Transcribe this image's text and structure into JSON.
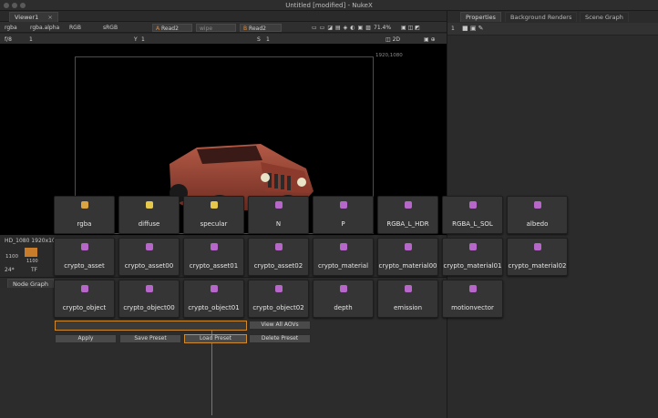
{
  "window": {
    "title": "Untitled [modified] - NukeX"
  },
  "viewer": {
    "tab_label": "Viewer1",
    "channels": "rgba",
    "alpha": "rgba.alpha",
    "colorspace_mode": "RGB",
    "lut": "sRGB",
    "input_a": "Read2",
    "wipe": "wipe",
    "input_b": "Read2",
    "zoom": "71.4%",
    "view_mode": "2D",
    "frame_field": "f/8",
    "frame_value": "1",
    "y_label": "Y",
    "y_value": "1",
    "s_label": "S",
    "s_value": "1",
    "format_label": "1920,1080",
    "status_format": "HD_1080 1920x1080",
    "timeline_left": "1100",
    "timeline_mark": "1100",
    "fps": "24*",
    "tf": "TF"
  },
  "node_graph": {
    "tab_label": "Node Graph"
  },
  "right_panel": {
    "tabs": [
      "Properties",
      "Background Renders",
      "Scene Graph"
    ],
    "count": "1"
  },
  "aov_panel": {
    "rows": [
      [
        "rgba",
        "diffuse",
        "specular",
        "N",
        "P",
        "RGBA_L_HDR",
        "RGBA_L_SOL",
        "albedo"
      ],
      [
        "crypto_asset",
        "crypto_asset00",
        "crypto_asset01",
        "crypto_asset02",
        "crypto_material",
        "crypto_material00",
        "crypto_material01",
        "crypto_material02"
      ],
      [
        "crypto_object",
        "crypto_object00",
        "crypto_object01",
        "crypto_object02",
        "depth",
        "emission",
        "motionvector"
      ]
    ],
    "icon_colors": {
      "rgba": "#d9a441",
      "light": "#e6c84a",
      "default": "#b766c9"
    },
    "preset_input": {
      "value": ""
    },
    "buttons": {
      "view_all": "View All AOVs",
      "apply": "Apply",
      "save": "Save Preset",
      "load": "Load Preset",
      "delete": "Delete Preset"
    }
  }
}
